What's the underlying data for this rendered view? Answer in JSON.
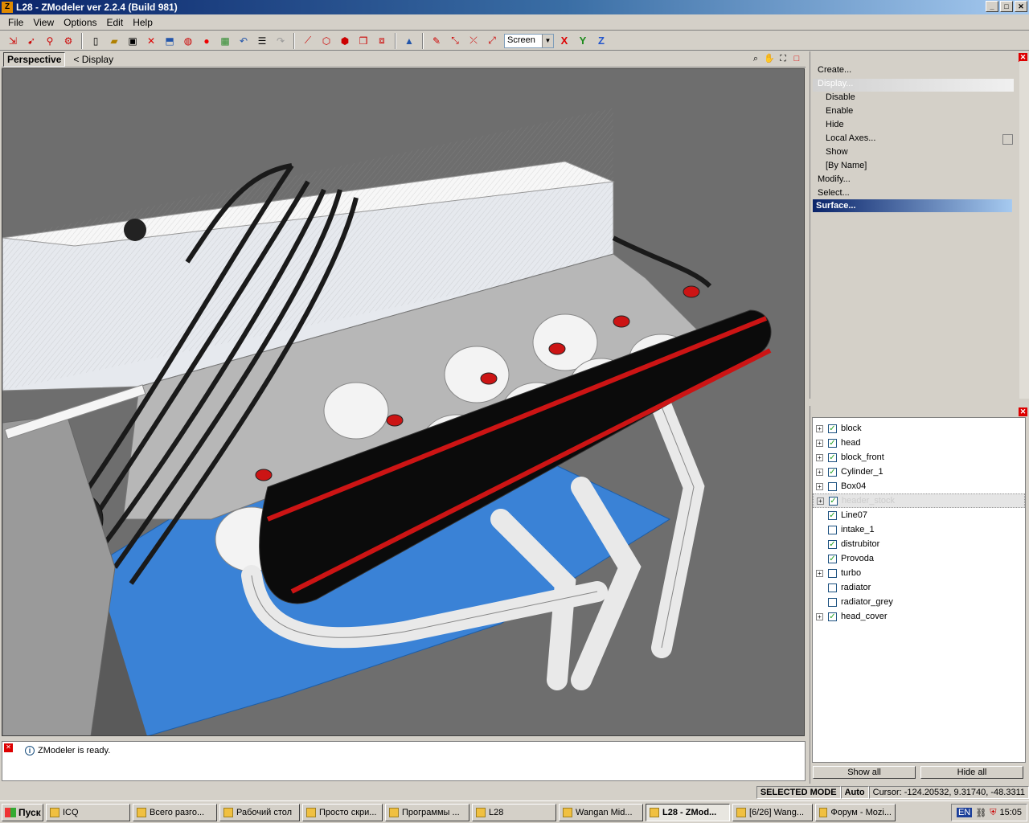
{
  "window": {
    "title": "L28 - ZModeler ver 2.2.4 (Build 981)",
    "app_icon": "Z"
  },
  "menu": [
    "File",
    "View",
    "Options",
    "Edit",
    "Help"
  ],
  "toolbar": {
    "coord_system": "Screen",
    "axes": [
      "X",
      "Y",
      "Z"
    ]
  },
  "viewport": {
    "name": "Perspective",
    "mode": "< Display"
  },
  "commands": {
    "items": [
      {
        "label": "Create...",
        "level": 0
      },
      {
        "label": "Display...",
        "level": 0,
        "state": "expanded"
      },
      {
        "label": "Disable",
        "level": 1
      },
      {
        "label": "Enable",
        "level": 1
      },
      {
        "label": "Hide",
        "level": 1
      },
      {
        "label": "Local Axes...",
        "level": 1
      },
      {
        "label": "Show",
        "level": 1
      },
      {
        "label": "[By Name]",
        "level": 1
      },
      {
        "label": "Modify...",
        "level": 0
      },
      {
        "label": "Select...",
        "level": 0
      },
      {
        "label": "Surface...",
        "level": 0,
        "state": "selected"
      }
    ]
  },
  "objects": {
    "items": [
      {
        "name": "block",
        "expandable": true,
        "checked": true
      },
      {
        "name": "head",
        "expandable": true,
        "checked": true
      },
      {
        "name": "block_front",
        "expandable": true,
        "checked": true
      },
      {
        "name": "Cylinder_1",
        "expandable": true,
        "checked": true
      },
      {
        "name": "Box04",
        "expandable": true,
        "checked": false
      },
      {
        "name": "header_stock",
        "expandable": true,
        "checked": true,
        "selected": true
      },
      {
        "name": "Line07",
        "expandable": false,
        "checked": true
      },
      {
        "name": "intake_1",
        "expandable": false,
        "checked": false
      },
      {
        "name": "distrubitor",
        "expandable": false,
        "checked": true
      },
      {
        "name": "Provoda",
        "expandable": false,
        "checked": true
      },
      {
        "name": "turbo",
        "expandable": true,
        "checked": false
      },
      {
        "name": "radiator",
        "expandable": false,
        "checked": false
      },
      {
        "name": "radiator_grey",
        "expandable": false,
        "checked": false
      },
      {
        "name": "head_cover",
        "expandable": true,
        "checked": true
      }
    ],
    "show_all": "Show all",
    "hide_all": "Hide all"
  },
  "log": {
    "message": "ZModeler is ready."
  },
  "status": {
    "mode": "SELECTED MODE",
    "auto": "Auto",
    "cursor": "Cursor: -124.20532, 9.31740, -48.3311"
  },
  "taskbar": {
    "start": "Пуск",
    "tasks": [
      "ICQ",
      "Всего разго...",
      "Рабочий стол",
      "Просто скри...",
      "Программы ...",
      "L28",
      "Wangan Mid...",
      "L28 - ZMod...",
      "[6/26] Wang...",
      "Форум - Mozi..."
    ],
    "active": "L28 - ZMod...",
    "lang": "EN",
    "clock": "15:05"
  },
  "colors": {
    "titlebar": "#0a246a",
    "viewport_bg": "#6e6e6e",
    "engine_block": "#3a82d6",
    "highlight": "#0a246a"
  }
}
